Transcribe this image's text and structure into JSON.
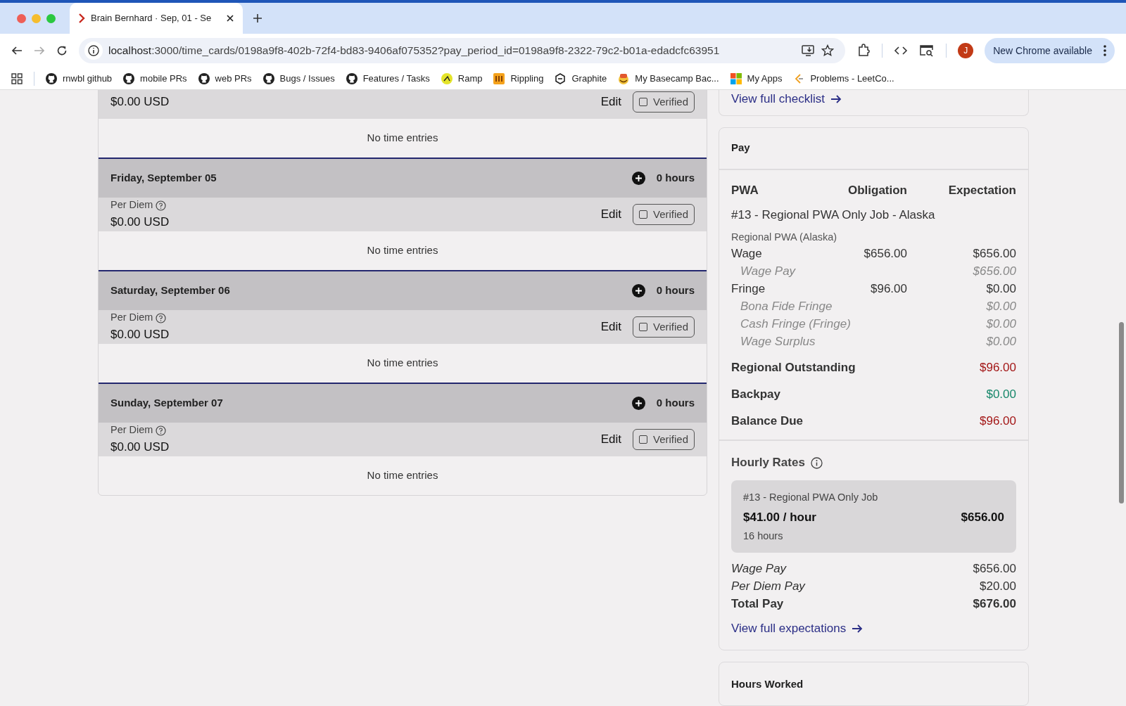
{
  "browser": {
    "tab_title": "Brain Bernhard · Sep, 01 - Se",
    "url_host": "localhost",
    "url_rest": ":3000/time_cards/0198a9f8-402b-72f4-bd83-9406af075352?pay_period_id=0198a9f8-2322-79c2-b01a-edadcfc63951",
    "profile_initial": "J",
    "update_button": "New Chrome available",
    "bookmarks": [
      {
        "label": "rnwbl github",
        "kind": "github"
      },
      {
        "label": "mobile PRs",
        "kind": "github"
      },
      {
        "label": "web PRs",
        "kind": "github"
      },
      {
        "label": "Bugs / Issues",
        "kind": "github"
      },
      {
        "label": "Features / Tasks",
        "kind": "github"
      },
      {
        "label": "Ramp",
        "kind": "ramp"
      },
      {
        "label": "Rippling",
        "kind": "rippling"
      },
      {
        "label": "Graphite",
        "kind": "graphite"
      },
      {
        "label": "My Basecamp Bac...",
        "kind": "basecamp"
      },
      {
        "label": "My Apps",
        "kind": "apps"
      },
      {
        "label": "Problems - LeetCo...",
        "kind": "leetcode"
      }
    ]
  },
  "days": [
    {
      "amount": "$0.00 USD",
      "edit": "Edit",
      "verified_label": "Verified",
      "verified": false,
      "entries": "No time entries"
    },
    {
      "date": "Friday, September 05",
      "hours": "0 hours",
      "per_diem_label": "Per Diem",
      "amount": "$0.00 USD",
      "edit": "Edit",
      "verified_label": "Verified",
      "verified": false,
      "entries": "No time entries"
    },
    {
      "date": "Saturday, September 06",
      "hours": "0 hours",
      "per_diem_label": "Per Diem",
      "amount": "$0.00 USD",
      "edit": "Edit",
      "verified_label": "Verified",
      "verified": false,
      "entries": "No time entries"
    },
    {
      "date": "Sunday, September 07",
      "hours": "0 hours",
      "per_diem_label": "Per Diem",
      "amount": "$0.00 USD",
      "edit": "Edit",
      "verified_label": "Verified",
      "verified": false,
      "entries": "No time entries"
    }
  ],
  "checklist_link": "View full checklist",
  "pay": {
    "title": "Pay",
    "columns": [
      "PWA",
      "Obligation",
      "Expectation"
    ],
    "job": "#13 - Regional PWA Only Job - Alaska",
    "region": "Regional PWA (Alaska)",
    "lines": [
      {
        "kind": "main",
        "label": "Wage",
        "obligation": "$656.00",
        "expectation": "$656.00"
      },
      {
        "kind": "sub",
        "label": "Wage Pay",
        "expectation": "$656.00"
      },
      {
        "kind": "main",
        "label": "Fringe",
        "obligation": "$96.00",
        "expectation": "$0.00"
      },
      {
        "kind": "sub",
        "label": "Bona Fide Fringe",
        "expectation": "$0.00"
      },
      {
        "kind": "sub",
        "label": "Cash Fringe (Fringe)",
        "expectation": "$0.00"
      },
      {
        "kind": "sub",
        "label": "Wage Surplus",
        "expectation": "$0.00"
      }
    ],
    "summary": [
      {
        "label": "Regional Outstanding",
        "value": "$96.00",
        "color": "#a31616"
      },
      {
        "label": "Backpay",
        "value": "$0.00",
        "color": "#16876a"
      },
      {
        "label": "Balance Due",
        "value": "$96.00",
        "color": "#a31616"
      }
    ],
    "hourly_title": "Hourly Rates",
    "rates": [
      {
        "job": "#13 - Regional PWA Only Job",
        "rate": "$41.00 / hour",
        "amount": "$656.00",
        "hours": "16 hours"
      }
    ],
    "totals": [
      {
        "kind": "italic",
        "label": "Wage Pay",
        "value": "$656.00"
      },
      {
        "kind": "italic",
        "label": "Per Diem Pay",
        "value": "$20.00"
      },
      {
        "kind": "bold",
        "label": "Total Pay",
        "value": "$676.00"
      }
    ],
    "link": "View full expectations"
  },
  "hours_worked": {
    "title": "Hours Worked"
  }
}
